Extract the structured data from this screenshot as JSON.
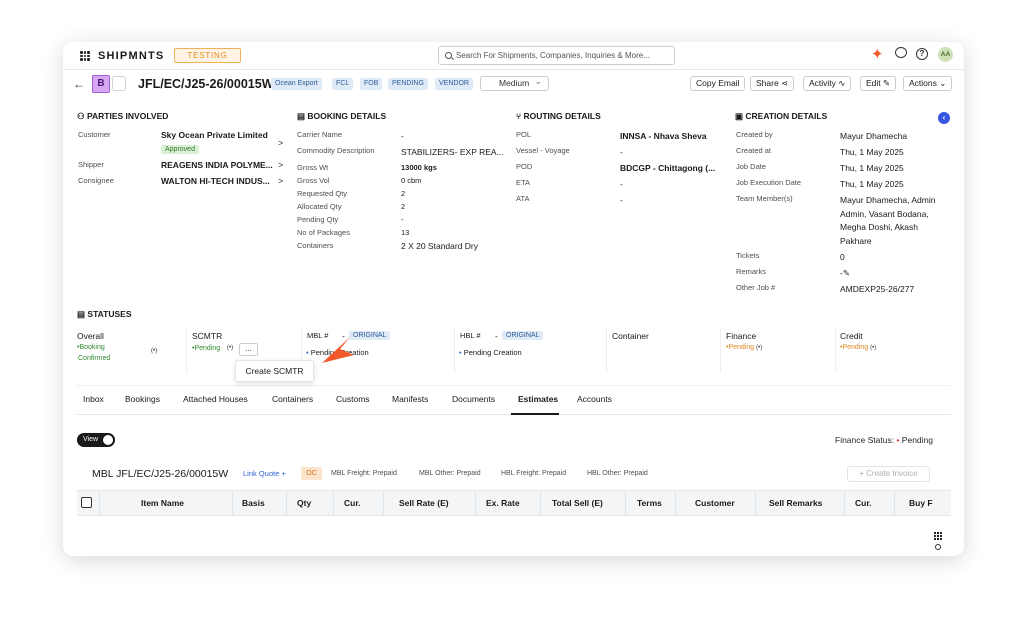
{
  "topbar": {
    "brand": "SHIPMNTS",
    "env_badge": "TESTING",
    "search_placeholder": "Search For Shipments, Companies, Inquiries & More...",
    "avatar_initials": "AA"
  },
  "header": {
    "type_badge": "B",
    "job_number": "JFL/EC/J25-26/00015W",
    "tags": [
      "Ocean Export",
      "FCL",
      "FOB",
      "PENDING",
      "VENDOR"
    ],
    "priority": "Medium",
    "buttons": {
      "copy_email": "Copy Email",
      "share": "Share",
      "activity": "Activity",
      "edit": "Edit",
      "actions": "Actions"
    }
  },
  "parties": {
    "title": "PARTIES INVOLVED",
    "customer_label": "Customer",
    "customer_value": "Sky Ocean Private Limited",
    "customer_status": "Approved",
    "shipper_label": "Shipper",
    "shipper_value": "REAGENS INDIA POLYME...",
    "consignee_label": "Consignee",
    "consignee_value": "WALTON HI-TECH INDUS..."
  },
  "booking": {
    "title": "BOOKING DETAILS",
    "rows": [
      {
        "label": "Carrier Name",
        "value": "-"
      },
      {
        "label": "Commodity Description",
        "value": "STABILIZERS- EXP REA..."
      },
      {
        "label": "Gross Wt",
        "value": "13000 kgs"
      },
      {
        "label": "Gross Vol",
        "value": "0 cbm"
      },
      {
        "label": "Requested Qty",
        "value": "2"
      },
      {
        "label": "Allocated Qty",
        "value": "2"
      },
      {
        "label": "Pending Qty",
        "value": "-"
      },
      {
        "label": "No of Packages",
        "value": "13"
      },
      {
        "label": "Containers",
        "value": "2 X 20 Standard Dry"
      }
    ]
  },
  "routing": {
    "title": "ROUTING DETAILS",
    "rows": [
      {
        "label": "POL",
        "value": "INNSA - Nhava Sheva"
      },
      {
        "label": "Vessel - Voyage",
        "value": "-"
      },
      {
        "label": "POD",
        "value": "BDCGP - Chittagong (..."
      },
      {
        "label": "ETA",
        "value": "-"
      },
      {
        "label": "ATA",
        "value": "-"
      }
    ]
  },
  "creation": {
    "title": "CREATION DETAILS",
    "created_by_label": "Created by",
    "created_by": "Mayur Dhamecha",
    "created_at_label": "Created at",
    "created_at": "Thu, 1 May 2025",
    "job_date_label": "Job Date",
    "job_date": "Thu, 1 May 2025",
    "exec_date_label": "Job Execution Date",
    "exec_date": "Thu, 1 May 2025",
    "team_label": "Team Member(s)",
    "team_lines": [
      "Mayur Dhamecha, Admin",
      "Admin, Vasant Bodana,",
      "Megha Doshi, Akash",
      "Pakhare"
    ],
    "tickets_label": "Tickets",
    "tickets": "0",
    "remarks_label": "Remarks",
    "remarks": "-",
    "other_job_label": "Other Job #",
    "other_job": "AMDEXP25-26/277"
  },
  "statuses": {
    "title": "STATUSES",
    "overall_label": "Overall",
    "overall_line1": "Booking",
    "overall_line2": "Confirmed",
    "scmtr_label": "SCMTR",
    "scmtr_status": "Pending",
    "mbl_label": "MBL #",
    "mbl_dash": "-",
    "mbl_badge": "ORIGINAL",
    "mbl_status": "Pending Creation",
    "hbl_label": "HBL #",
    "hbl_dash": "-",
    "hbl_badge": "ORIGINAL",
    "hbl_status": "Pending Creation",
    "container_label": "Container",
    "finance_label": "Finance",
    "finance_status": "Pending",
    "credit_label": "Credit",
    "credit_status": "Pending",
    "more_button": "...",
    "popup_item": "Create SCMTR"
  },
  "tabs": [
    "Inbox",
    "Bookings",
    "Attached Houses",
    "Containers",
    "Customs",
    "Manifests",
    "Documents",
    "Estimates",
    "Accounts"
  ],
  "estimates": {
    "view_toggle": "View",
    "finance_status_label": "Finance Status:",
    "finance_status_value": "Pending",
    "mbl_title": "MBL JFL/EC/J25-26/00015W",
    "link_quote": "Link Quote",
    "oc_badge": "OC",
    "freight_notes": [
      "MBL Freight: Prepaid",
      "MBL Other: Prepaid",
      "HBL Freight: Prepaid",
      "HBL Other: Prepaid"
    ],
    "create_invoice": "+ Create Invoice",
    "columns": [
      "Item Name",
      "Basis",
      "Qty",
      "Cur.",
      "Sell Rate (E)",
      "Ex. Rate",
      "Total Sell (E)",
      "Terms",
      "Customer",
      "Sell Remarks",
      "Cur.",
      "Buy F"
    ]
  },
  "colors": {
    "accent": "#f2592a",
    "tag_bg": "#dfeaf7",
    "approved": "#2f7a2a",
    "pending_orange": "#e08a1e",
    "link_blue": "#2f5fd6"
  }
}
